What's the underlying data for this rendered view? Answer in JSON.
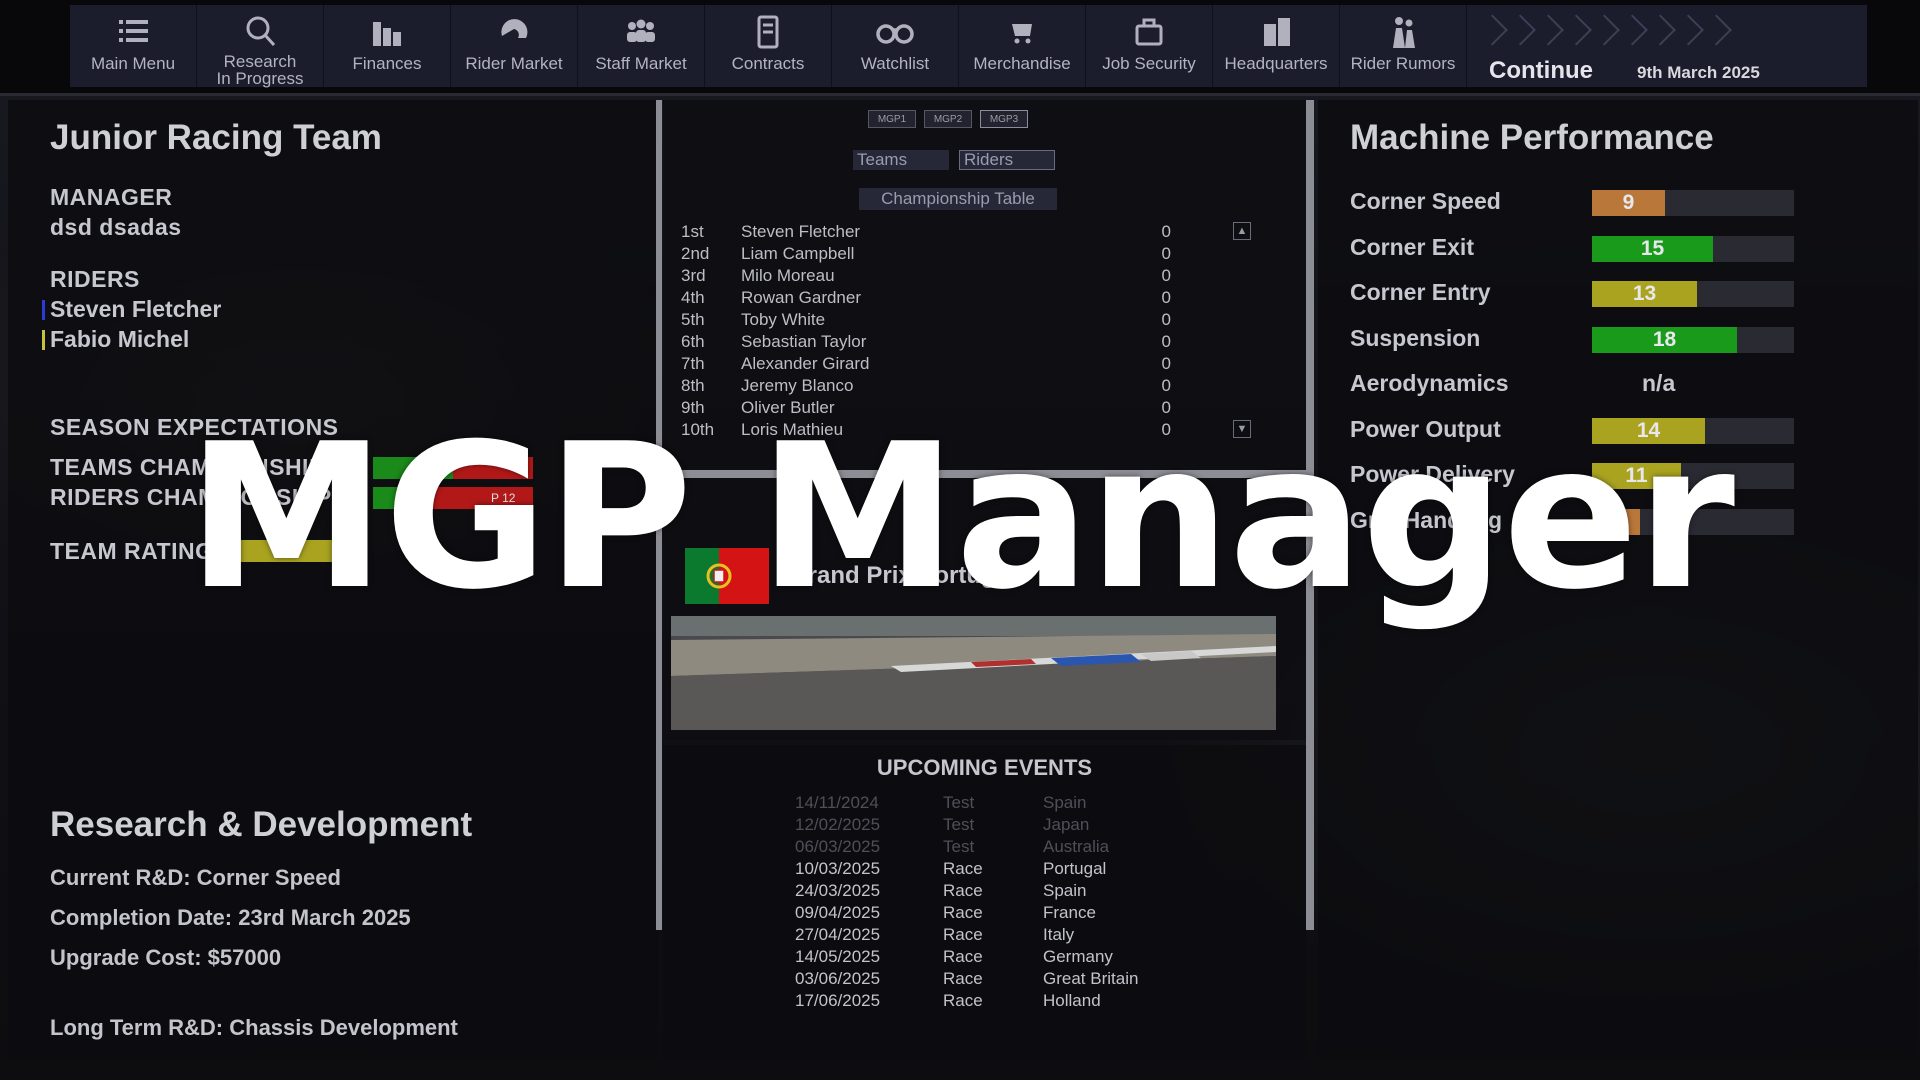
{
  "nav": {
    "items": [
      {
        "label": "Main Menu",
        "icon": "list-icon"
      },
      {
        "label": "Research\nIn Progress",
        "icon": "research-icon"
      },
      {
        "label": "Finances",
        "icon": "finances-icon"
      },
      {
        "label": "Rider Market",
        "icon": "helmet-icon"
      },
      {
        "label": "Staff Market",
        "icon": "people-icon"
      },
      {
        "label": "Contracts",
        "icon": "contract-icon"
      },
      {
        "label": "Watchlist",
        "icon": "binoculars-icon"
      },
      {
        "label": "Merchandise",
        "icon": "cart-icon"
      },
      {
        "label": "Job Security",
        "icon": "briefcase-icon"
      },
      {
        "label": "Headquarters",
        "icon": "headquarters-icon"
      },
      {
        "label": "Rider Rumors",
        "icon": "rumors-icon"
      }
    ],
    "continue_label": "Continue",
    "date": "9th March 2025"
  },
  "left": {
    "team_name": "Junior Racing Team",
    "manager_heading": "MANAGER",
    "manager_name": "dsd dsadas",
    "riders_heading": "RIDERS",
    "riders": [
      {
        "name": "Steven Fletcher",
        "color": "#2b3bd8"
      },
      {
        "name": "Fabio Michel",
        "color": "#c8c23a"
      }
    ],
    "season_heading": "SEASON EXPECTATIONS",
    "teams_championship": "TEAMS CHAMPIONSHIP",
    "riders_championship": "RIDERS CHAMPIONSHIP",
    "riders_champ_badge": "P 12",
    "team_rating": "TEAM RATING",
    "rd": {
      "title": "Research & Development",
      "current": "Current R&D: Corner Speed",
      "completion": "Completion Date: 23rd March 2025",
      "cost": "Upgrade Cost: $57000",
      "long_term": "Long Term R&D: Chassis Development"
    }
  },
  "standings": {
    "classes": [
      "MGP1",
      "MGP2",
      "MGP3"
    ],
    "view_tabs": [
      "Teams",
      "Riders"
    ],
    "table_title": "Championship Table",
    "rows": [
      {
        "pos": "1st",
        "name": "Steven Fletcher",
        "pts": "0"
      },
      {
        "pos": "2nd",
        "name": "Liam Campbell",
        "pts": "0"
      },
      {
        "pos": "3rd",
        "name": "Milo Moreau",
        "pts": "0"
      },
      {
        "pos": "4th",
        "name": "Rowan Gardner",
        "pts": "0"
      },
      {
        "pos": "5th",
        "name": "Toby White",
        "pts": "0"
      },
      {
        "pos": "6th",
        "name": "Sebastian Taylor",
        "pts": "0"
      },
      {
        "pos": "7th",
        "name": "Alexander Girard",
        "pts": "0"
      },
      {
        "pos": "8th",
        "name": "Jeremy Blanco",
        "pts": "0"
      },
      {
        "pos": "9th",
        "name": "Oliver Butler",
        "pts": "0"
      },
      {
        "pos": "10th",
        "name": "Loris Mathieu",
        "pts": "0"
      }
    ]
  },
  "next_event": {
    "gp_name": "Grand Prix Portugal",
    "flag_colors": [
      "#0b7a2e",
      "#d41414"
    ]
  },
  "upcoming": {
    "heading": "UPCOMING EVENTS",
    "events": [
      {
        "date": "14/11/2024",
        "type": "Test",
        "location": "Spain",
        "past": true
      },
      {
        "date": "12/02/2025",
        "type": "Test",
        "location": "Japan",
        "past": true
      },
      {
        "date": "06/03/2025",
        "type": "Test",
        "location": "Australia",
        "past": true
      },
      {
        "date": "10/03/2025",
        "type": "Race",
        "location": "Portugal",
        "past": false
      },
      {
        "date": "24/03/2025",
        "type": "Race",
        "location": "Spain",
        "past": false
      },
      {
        "date": "09/04/2025",
        "type": "Race",
        "location": "France",
        "past": false
      },
      {
        "date": "27/04/2025",
        "type": "Race",
        "location": "Italy",
        "past": false
      },
      {
        "date": "14/05/2025",
        "type": "Race",
        "location": "Germany",
        "past": false
      },
      {
        "date": "03/06/2025",
        "type": "Race",
        "location": "Great Britain",
        "past": false
      },
      {
        "date": "17/06/2025",
        "type": "Race",
        "location": "Holland",
        "past": false
      }
    ]
  },
  "machine": {
    "title": "Machine Performance",
    "max": 25,
    "stats": [
      {
        "label": "Corner Speed",
        "value": 9,
        "display": "9",
        "color": "#b9773a"
      },
      {
        "label": "Corner Exit",
        "value": 15,
        "display": "15",
        "color": "#1a9a1a"
      },
      {
        "label": "Corner Entry",
        "value": 13,
        "display": "13",
        "color": "#a9a320"
      },
      {
        "label": "Suspension",
        "value": 18,
        "display": "18",
        "color": "#1a9a1a"
      },
      {
        "label": "Aerodynamics",
        "value": null,
        "display": "n/a",
        "color": ""
      },
      {
        "label": "Power Output",
        "value": 14,
        "display": "14",
        "color": "#a9a320"
      },
      {
        "label": "Power Delivery",
        "value": 11,
        "display": "11",
        "color": "#a9a320"
      },
      {
        "label": "Grip Handling",
        "value": 6,
        "display": "",
        "color": "#b9773a"
      }
    ]
  },
  "overlay_title": "MGP Manager"
}
